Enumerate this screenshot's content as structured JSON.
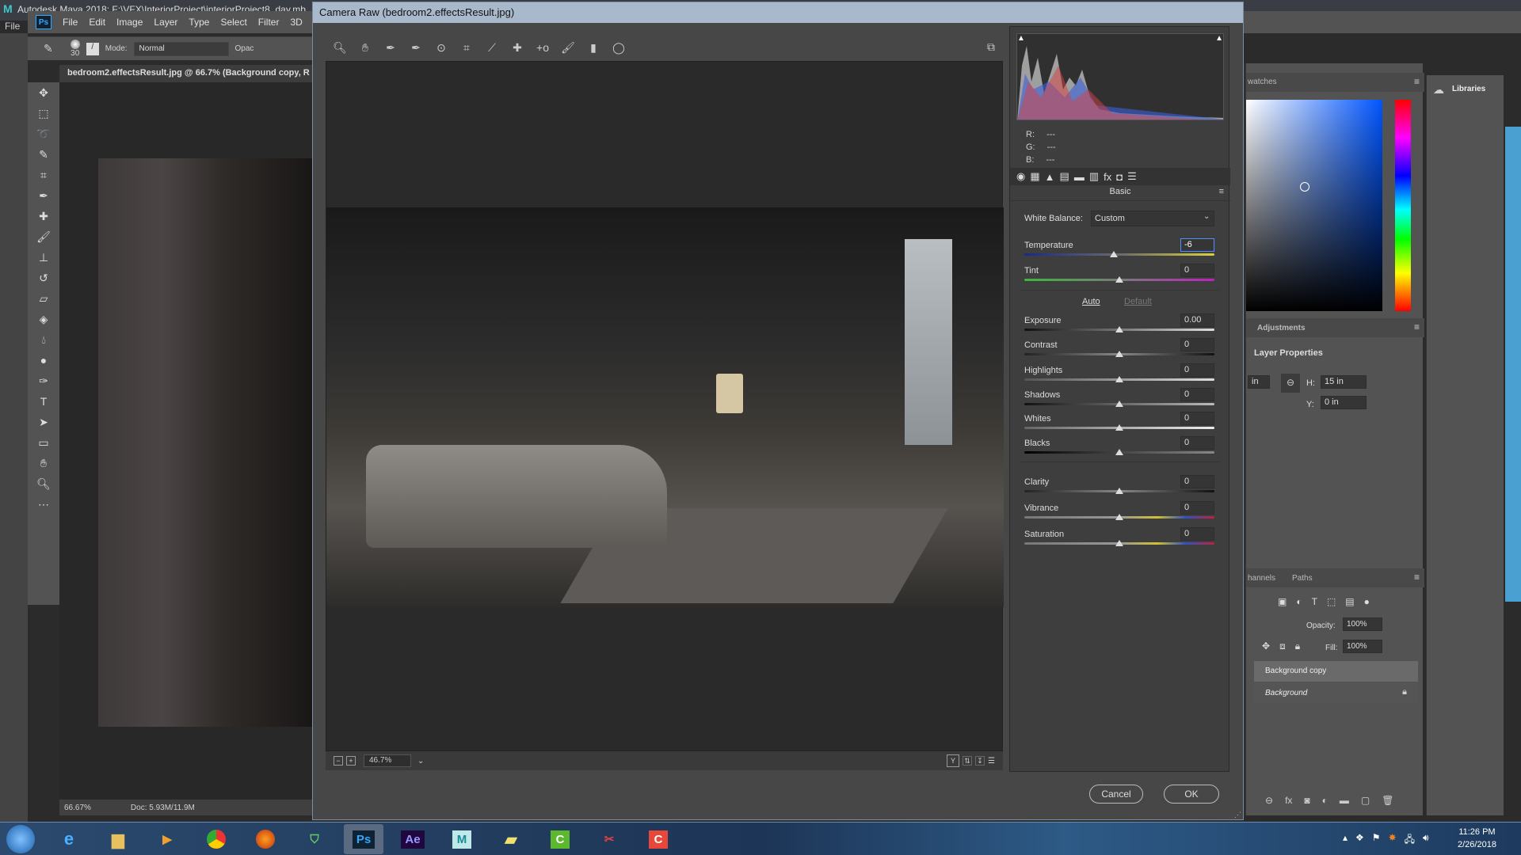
{
  "maya": {
    "title": "Autodesk Maya 2018: F:\\VFX\\InteriorProject\\interiorProject8_day.mb",
    "menu_file": "File",
    "logo": "M"
  },
  "photoshop": {
    "logo": "Ps",
    "menu": [
      "File",
      "Edit",
      "Image",
      "Layer",
      "Type",
      "Select",
      "Filter",
      "3D"
    ],
    "options": {
      "brush_size": "30",
      "mode_label": "Mode:",
      "mode_value": "Normal",
      "opacity_label": "Opac"
    },
    "doc_tab": "bedroom2.effectsResult.jpg @ 66.7% (Background copy, R",
    "status": {
      "zoom": "66.67%",
      "doc": "Doc: 5.93M/11.9M"
    },
    "tools": [
      "move",
      "marquee",
      "lasso",
      "quick-select",
      "crop",
      "eyedropper",
      "healing",
      "brush",
      "stamp",
      "history-brush",
      "eraser",
      "paint-bucket",
      "blur",
      "dodge",
      "pen",
      "type",
      "path-select",
      "rectangle",
      "hand",
      "zoom",
      "more"
    ]
  },
  "camera_raw": {
    "title": "Camera Raw (bedroom2.effectsResult.jpg)",
    "toolbar": [
      "zoom",
      "hand",
      "white-balance",
      "color-sampler",
      "targeted-adjustment",
      "crop",
      "straighten",
      "spot-removal",
      "red-eye",
      "adjustment-brush",
      "graduated-filter",
      "radial-filter"
    ],
    "histogram": {
      "r": "R:",
      "g": "G:",
      "b": "B:",
      "r_val": "---",
      "g_val": "---",
      "b_val": "---"
    },
    "panel_title": "Basic",
    "white_balance": {
      "label": "White Balance:",
      "value": "Custom"
    },
    "auto_label": "Auto",
    "default_label": "Default",
    "sliders": [
      {
        "label": "Temperature",
        "value": "-6",
        "pos": 0.47,
        "gradient": "linear-gradient(90deg,#1a2a8a,#6a6a6a 50%,#d8d040)",
        "selected": true
      },
      {
        "label": "Tint",
        "value": "0",
        "pos": 0.5,
        "gradient": "linear-gradient(90deg,#3cb83c,#7a7a7a 50%,#c020c0)"
      },
      {
        "label": "Exposure",
        "value": "0.00",
        "pos": 0.5,
        "gradient": "linear-gradient(90deg,#111,#ddd)"
      },
      {
        "label": "Contrast",
        "value": "0",
        "pos": 0.5,
        "gradient": "linear-gradient(90deg,#222,#888,#111)"
      },
      {
        "label": "Highlights",
        "value": "0",
        "pos": 0.5,
        "gradient": "linear-gradient(90deg,#555,#ddd)"
      },
      {
        "label": "Shadows",
        "value": "0",
        "pos": 0.5,
        "gradient": "linear-gradient(90deg,#111,#bbb)"
      },
      {
        "label": "Whites",
        "value": "0",
        "pos": 0.5,
        "gradient": "linear-gradient(90deg,#666,#eee)"
      },
      {
        "label": "Blacks",
        "value": "0",
        "pos": 0.5,
        "gradient": "linear-gradient(90deg,#000,#888)"
      },
      {
        "label": "Clarity",
        "value": "0",
        "pos": 0.5,
        "gradient": "linear-gradient(90deg,#222,#888,#111)"
      },
      {
        "label": "Vibrance",
        "value": "0",
        "pos": 0.5,
        "gradient": "linear-gradient(90deg,#777,#999 50%,#d0c030 70%,#3050c0 85%,#c02040)"
      },
      {
        "label": "Saturation",
        "value": "0",
        "pos": 0.5,
        "gradient": "linear-gradient(90deg,#777,#999 50%,#d0c030 70%,#3050c0 85%,#c02040)"
      }
    ],
    "zoom_level": "46.7%",
    "cancel": "Cancel",
    "ok": "OK"
  },
  "panels": {
    "swatches_tab": "watches",
    "libraries": "Libraries",
    "adjustments_tab": "Adjustments",
    "layer_properties": "Layer Properties",
    "w_value": "in",
    "h_label": "H:",
    "h_value": "15 in",
    "y_label": "Y:",
    "y_value": "0 in",
    "channels_tab": "hannels",
    "paths_tab": "Paths",
    "opacity_label": "Opacity:",
    "opacity_value": "100%",
    "fill_label": "Fill:",
    "fill_value": "100%",
    "layers": [
      {
        "name": "Background copy",
        "selected": true
      },
      {
        "name": "Background",
        "locked": true
      }
    ]
  },
  "taskbar": {
    "apps": [
      "Ps",
      "Ae",
      "M",
      "",
      "C",
      "",
      "C"
    ],
    "time": "11:26 PM",
    "date": "2/26/2018"
  },
  "colors": {
    "accent": "#4d90fe",
    "ps_blue": "#31a8ff",
    "ae_purple": "#9999ff",
    "selection": "#3a78d8"
  }
}
